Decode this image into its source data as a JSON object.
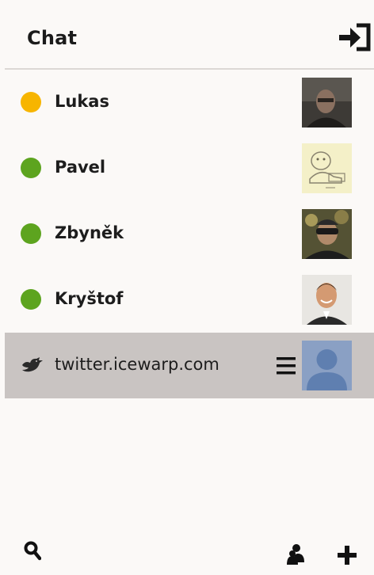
{
  "header": {
    "title": "Chat",
    "logout_icon": "sign-in-icon"
  },
  "contacts": [
    {
      "name": "Lukas",
      "status": "away",
      "status_color": "#f7b500",
      "avatar": "photo-man-dark"
    },
    {
      "name": "Pavel",
      "status": "online",
      "status_color": "#5da41f",
      "avatar": "cartoon-sketch"
    },
    {
      "name": "Zbyněk",
      "status": "online",
      "status_color": "#5da41f",
      "avatar": "photo-man-sunglasses"
    },
    {
      "name": "Kryštof",
      "status": "online",
      "status_color": "#5da41f",
      "avatar": "photo-man-smiling"
    }
  ],
  "service": {
    "name": "twitter.icewarp.com",
    "icon": "twitter-bird-icon",
    "menu_icon": "hamburger-menu-icon",
    "avatar": "default-user-silhouette"
  },
  "footer": {
    "search_icon": "search-icon",
    "users_icon": "users-icon",
    "add_icon": "plus-icon"
  },
  "colors": {
    "background": "#fbf9f7",
    "selected_row": "#c9c4c2",
    "away": "#f7b500",
    "online": "#5da41f",
    "text": "#1d1d1d",
    "placeholder_avatar": "#8aa0c4"
  }
}
